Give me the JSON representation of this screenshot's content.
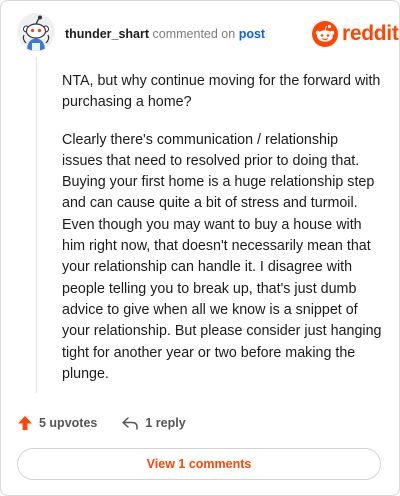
{
  "comment": {
    "username": "thunder_shart",
    "action_text": "commented on",
    "post_link_text": "post",
    "paragraphs": [
      "NTA, but why continue moving for the forward with purchasing a home?",
      "Clearly there's communication / relationship issues that need to resolved prior to doing that. Buying your first home is a huge relationship step and can cause quite a bit of stress and turmoil. Even though you may want to buy a house with him right now, that doesn't necessarily mean that your relationship can handle it. I disagree with people telling you to break up, that's just dumb advice to give when all we know is a snippet of your relationship. But please consider just hanging tight for another year or two before making the plunge."
    ]
  },
  "brand": {
    "name": "reddit",
    "icon": "reddit-alien-icon",
    "color": "#ff4500"
  },
  "actions": {
    "upvotes_label": "5 upvotes",
    "upvote_icon": "upvote-arrow-icon",
    "reply_label": "1 reply",
    "reply_icon": "reply-arrow-icon"
  },
  "view_button_label": "View 1 comments",
  "colors": {
    "accent": "#ff4500",
    "link": "#0f63c8",
    "muted": "#7c7c7c"
  }
}
